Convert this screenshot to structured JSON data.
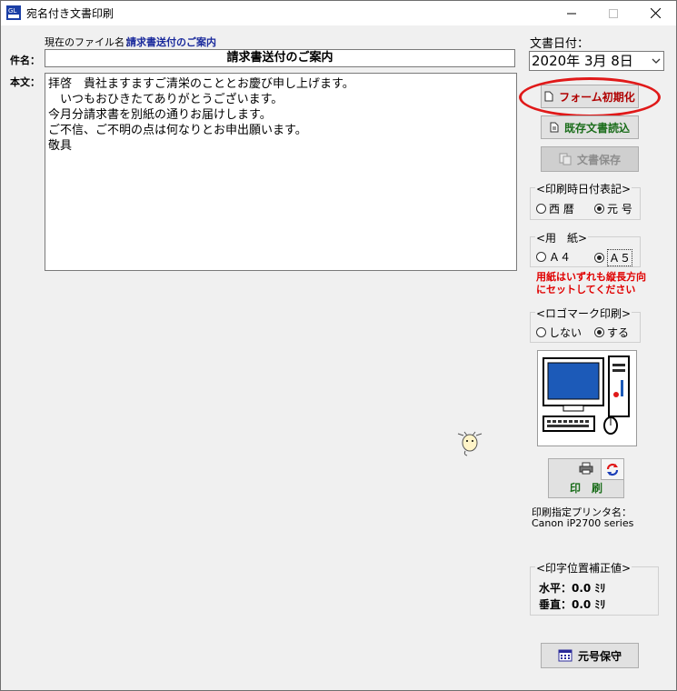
{
  "window": {
    "title": "宛名付き文書印刷"
  },
  "file": {
    "label": "現在のファイル名：",
    "name": "請求書送付のご案内"
  },
  "subject": {
    "label": "件名：",
    "value": "請求書送付のご案内"
  },
  "body": {
    "label": "本文：",
    "lines": [
      "拝啓　貴社ますますご清栄のこととお慶び申し上げます。",
      "　いつもおひきたてありがとうございます。",
      "今月分請求書を別紙の通りお届けします。",
      "ご不信、ご不明の点は何なりとお申出願います。",
      "敬具"
    ]
  },
  "date": {
    "label": "文書日付：",
    "value": "2020年 3月 8日"
  },
  "buttons": {
    "form_init": "フォーム初期化",
    "load_doc": "既存文書読込",
    "save_doc": "文書保存",
    "print": "印　刷",
    "save_era": "元号保守"
  },
  "print_date_format": {
    "title": "<印刷時日付表記>",
    "options": [
      "西 暦",
      "元 号"
    ],
    "selected": "元 号"
  },
  "paper": {
    "title": "<用　紙>",
    "options": [
      "Ａ４",
      "Ａ５"
    ],
    "selected": "Ａ５",
    "note_line1": "用紙はいずれも縦長方向",
    "note_line2": "にセットしてください"
  },
  "logo_print": {
    "title": "<ロゴマーク印刷>",
    "options": [
      "しない",
      "する"
    ],
    "selected": "する"
  },
  "printer": {
    "label": "印刷指定プリンタ名：",
    "name": "Canon iP2700 series"
  },
  "offset": {
    "title": "<印字位置補正値>",
    "horizontal": "水平：0.0 ﾐﾘ",
    "vertical": "垂直：0.0 ﾐﾘ"
  },
  "colors": {
    "accent_red": "#e01919",
    "label_blue": "#1a2a9c",
    "window_bg": "#f0f0f0"
  }
}
